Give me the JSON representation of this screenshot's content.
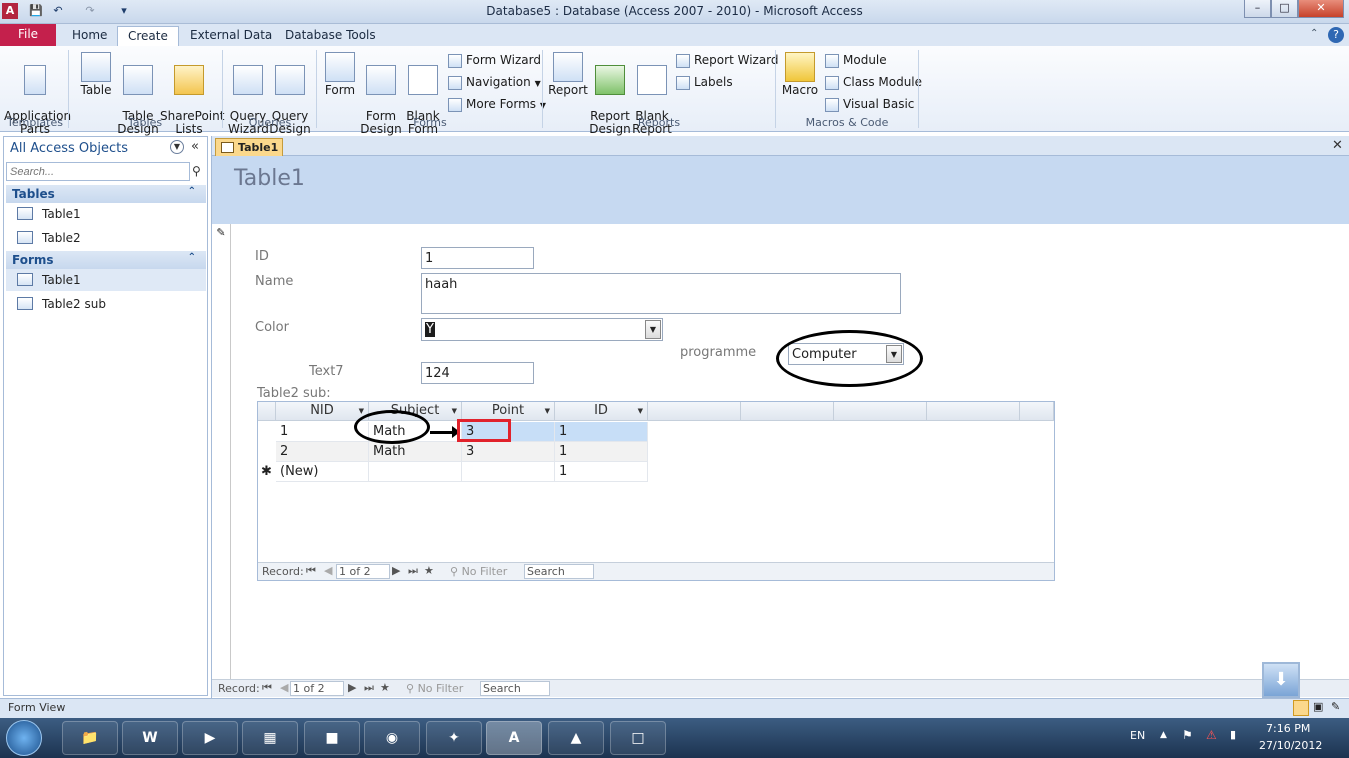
{
  "window": {
    "title": "Database5 : Database (Access 2007 - 2010)  -  Microsoft Access",
    "app_letter": "A"
  },
  "ribbon_tabs": [
    "Home",
    "Create",
    "External Data",
    "Database Tools"
  ],
  "file_tab": "File",
  "active_tab": "Create",
  "ribbon": {
    "templates": {
      "label": "Templates",
      "app_parts": "Application\nParts"
    },
    "tables": {
      "label": "Tables",
      "table": "Table",
      "table_design": "Table\nDesign",
      "sharepoint": "SharePoint\nLists"
    },
    "queries": {
      "label": "Queries",
      "wizard": "Query\nWizard",
      "design": "Query\nDesign"
    },
    "forms": {
      "label": "Forms",
      "form": "Form",
      "form_design": "Form\nDesign",
      "blank_form": "Blank\nForm",
      "form_wizard": "Form Wizard",
      "navigation": "Navigation",
      "more_forms": "More Forms"
    },
    "reports": {
      "label": "Reports",
      "report": "Report",
      "report_design": "Report\nDesign",
      "blank_report": "Blank\nReport",
      "report_wizard": "Report Wizard",
      "labels": "Labels"
    },
    "macros": {
      "label": "Macros & Code",
      "macro": "Macro",
      "module": "Module",
      "class_module": "Class Module",
      "visual_basic": "Visual Basic"
    }
  },
  "nav_pane": {
    "title": "All Access Objects",
    "search_placeholder": "Search...",
    "groups": [
      {
        "name": "Tables",
        "items": [
          "Table1",
          "Table2"
        ]
      },
      {
        "name": "Forms",
        "items": [
          "Table1",
          "Table2 sub"
        ]
      }
    ]
  },
  "document": {
    "tab_label": "Table1",
    "form_title": "Table1",
    "fields": {
      "id_label": "ID",
      "id_value": "1",
      "name_label": "Name",
      "name_value": "haah",
      "color_label": "Color",
      "color_value": "Y",
      "programme_label": "programme",
      "programme_value": "Computer",
      "text7_label": "Text7",
      "text7_value": "124"
    },
    "subform": {
      "label": "Table2 sub:",
      "columns": [
        "NID",
        "Subject",
        "Point",
        "ID"
      ],
      "rows": [
        [
          "1",
          "Math",
          "3",
          "1"
        ],
        [
          "2",
          "Math",
          "3",
          "1"
        ],
        [
          "(New)",
          "",
          "",
          "1"
        ]
      ],
      "record_label": "Record:",
      "record_value": "1 of 2",
      "no_filter": "No Filter",
      "search": "Search"
    },
    "record_label": "Record:",
    "record_value": "1 of 2",
    "no_filter": "No Filter",
    "search": "Search"
  },
  "status": {
    "text": "Form View"
  },
  "taskbar": {
    "lang": "EN",
    "time": "7:16 PM",
    "date": "27/10/2012"
  }
}
